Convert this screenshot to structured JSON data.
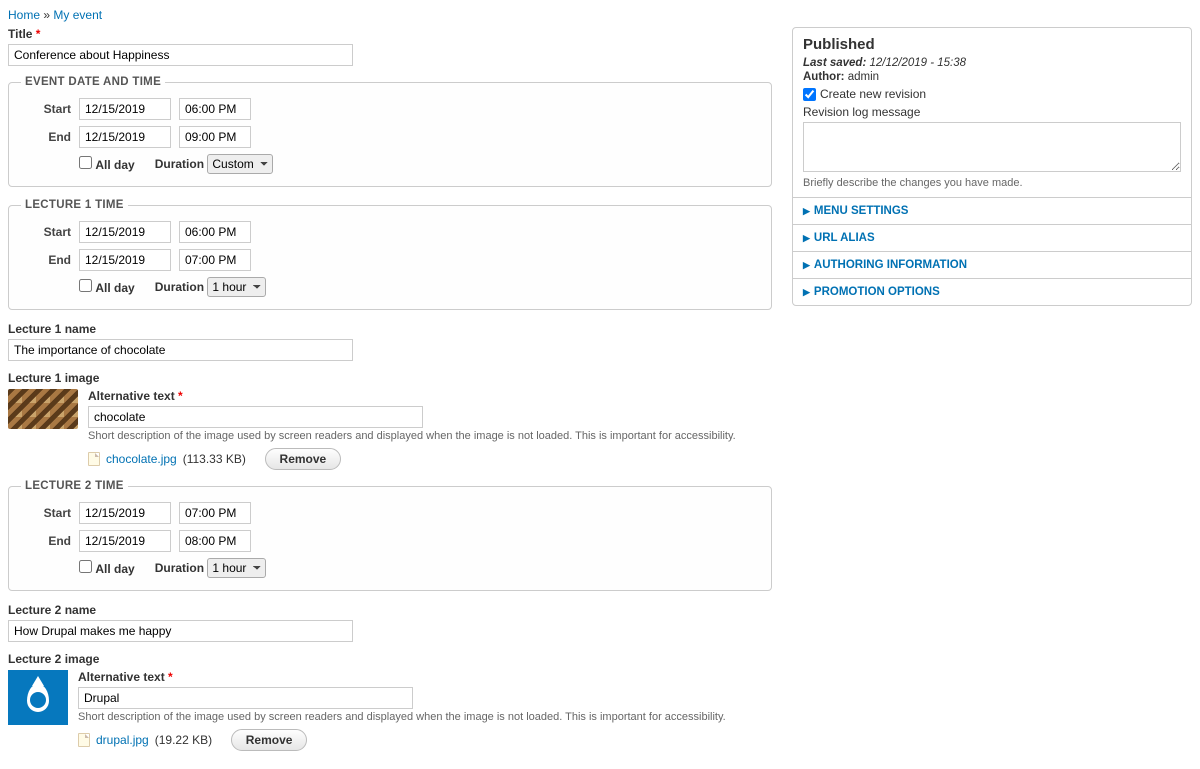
{
  "breadcrumb": {
    "home": "Home",
    "sep": "»",
    "current": "My event"
  },
  "title": {
    "label": "Title",
    "value": "Conference about Happiness"
  },
  "event_dt": {
    "legend": "EVENT DATE AND TIME",
    "start_label": "Start",
    "start_date": "12/15/2019",
    "start_time": "06:00 PM",
    "end_label": "End",
    "end_date": "12/15/2019",
    "end_time": "09:00 PM",
    "allday_label": "All day",
    "duration_label": "Duration",
    "duration_value": "Custom"
  },
  "lec1_dt": {
    "legend": "LECTURE 1 TIME",
    "start_label": "Start",
    "start_date": "12/15/2019",
    "start_time": "06:00 PM",
    "end_label": "End",
    "end_date": "12/15/2019",
    "end_time": "07:00 PM",
    "allday_label": "All day",
    "duration_label": "Duration",
    "duration_value": "1 hour"
  },
  "lec1_name": {
    "label": "Lecture 1 name",
    "value": "The importance of chocolate"
  },
  "lec1_image": {
    "label": "Lecture 1 image",
    "alt_label": "Alternative text",
    "alt_value": "chocolate",
    "help": "Short description of the image used by screen readers and displayed when the image is not loaded. This is important for accessibility.",
    "file_name": "chocolate.jpg",
    "file_size": "(113.33 KB)",
    "remove": "Remove"
  },
  "lec2_dt": {
    "legend": "LECTURE 2 TIME",
    "start_label": "Start",
    "start_date": "12/15/2019",
    "start_time": "07:00 PM",
    "end_label": "End",
    "end_date": "12/15/2019",
    "end_time": "08:00 PM",
    "allday_label": "All day",
    "duration_label": "Duration",
    "duration_value": "1 hour"
  },
  "lec2_name": {
    "label": "Lecture 2 name",
    "value": "How Drupal makes me happy"
  },
  "lec2_image": {
    "label": "Lecture 2 image",
    "alt_label": "Alternative text",
    "alt_value": "Drupal",
    "help": "Short description of the image used by screen readers and displayed when the image is not loaded. This is important for accessibility.",
    "file_name": "drupal.jpg",
    "file_size": "(19.22 KB)",
    "remove": "Remove"
  },
  "sidebar": {
    "published": "Published",
    "last_saved_label": "Last saved:",
    "last_saved_value": "12/12/2019 - 15:38",
    "author_label": "Author:",
    "author_value": "admin",
    "create_rev": "Create new revision",
    "rev_log_label": "Revision log message",
    "rev_help": "Briefly describe the changes you have made.",
    "menu_settings": "MENU SETTINGS",
    "url_alias": "URL ALIAS",
    "auth_info": "AUTHORING INFORMATION",
    "promo_opts": "PROMOTION OPTIONS"
  }
}
